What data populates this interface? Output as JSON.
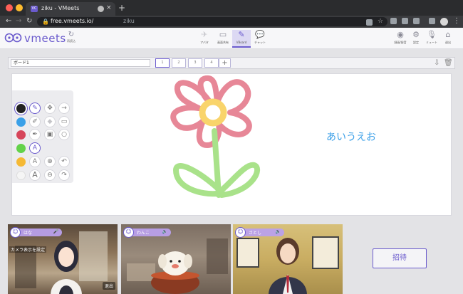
{
  "browser": {
    "tab_title": "ziku - VMeets",
    "tab_favicon": "VC",
    "url_host": "free.vmeets.io/",
    "url_path": "ziku",
    "new_tab": "+",
    "close_tab": "×"
  },
  "app": {
    "logo_text": "vmeets",
    "reload_label": "再読込",
    "toolbar": [
      {
        "id": "avatar",
        "label": "アバタ",
        "icon": "person-icon"
      },
      {
        "id": "screen-share",
        "label": "画面共有",
        "icon": "monitor-icon"
      },
      {
        "id": "vboard",
        "label": "VBoard",
        "icon": "pen-icon"
      },
      {
        "id": "chat",
        "label": "チャット",
        "icon": "chat-icon"
      }
    ],
    "right_toolbar": [
      {
        "id": "record",
        "label": "録画/録音",
        "icon": "record-icon"
      },
      {
        "id": "settings",
        "label": "設定",
        "icon": "gear-icon"
      },
      {
        "id": "mute",
        "label": "ミュート",
        "icon": "mic-icon"
      },
      {
        "id": "leave",
        "label": "退出",
        "icon": "exit-icon"
      }
    ]
  },
  "board": {
    "name": "ボード1",
    "pages": [
      "1",
      "2",
      "3",
      "4"
    ],
    "add_page": "+",
    "text": "あいうえお",
    "palette_colors": [
      "#222222",
      "#3aa0e8",
      "#d6455a",
      "#63d24a",
      "#f5b935",
      "#f2f2f2"
    ],
    "selected_color": "#222222"
  },
  "participants": [
    {
      "name": "はな",
      "overlay": "カメラ表示を設定",
      "leave": "退出"
    },
    {
      "name": "わんこ"
    },
    {
      "name": "さとし"
    }
  ],
  "invite_label": "招待"
}
